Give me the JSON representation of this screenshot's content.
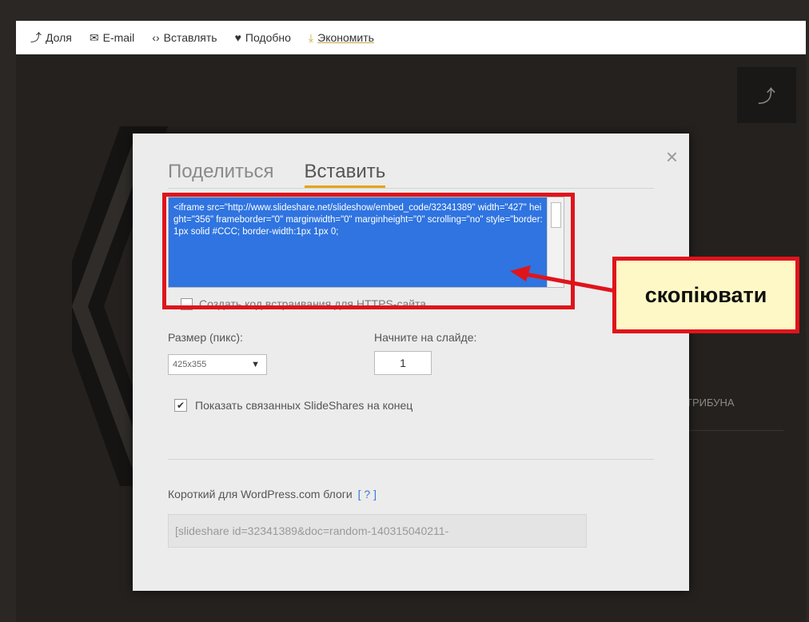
{
  "toolbar": {
    "items": [
      {
        "label": "Доля",
        "icon": "share-icon"
      },
      {
        "label": "E-mail",
        "icon": "envelope-icon"
      },
      {
        "label": "Вставлять",
        "icon": "code-icon"
      },
      {
        "label": "Подобно",
        "icon": "heart-icon"
      },
      {
        "label": "Экономить",
        "icon": "download-icon"
      }
    ]
  },
  "modal": {
    "tabs": [
      "Поделиться",
      "Вставить"
    ],
    "active_tab": "Вставить",
    "close_glyph": "×",
    "embed_code": "<iframe src=\"http://www.slideshare.net/slideshow/embed_code/32341389\" width=\"427\" height=\"356\" frameborder=\"0\" marginwidth=\"0\" marginheight=\"0\" scrolling=\"no\" style=\"border:1px solid #CCC; border-width:1px 1px 0;",
    "https_label": "Создать код встраивания для HTTPS-сайта",
    "size_label": "Размер (пикс):",
    "size_value": "425x355",
    "start_label": "Начните на слайде:",
    "start_value": "1",
    "related_label": "Показать связанных SlideShares на конец",
    "related_checked": true,
    "wp_label": "Короткий для WordPress.com блоги",
    "wp_help": "[ ? ]",
    "wp_value": "[slideshare id=32341389&doc=random-140315040211-"
  },
  "annotation": {
    "callout_text": "скопіювати"
  },
  "background": {
    "text_fragment": "ТРИБУНА"
  },
  "colors": {
    "selection": "#2f74e0",
    "highlight_red": "#e0141b",
    "tab_accent": "#e7a316",
    "callout_bg": "#fdf8c5"
  }
}
